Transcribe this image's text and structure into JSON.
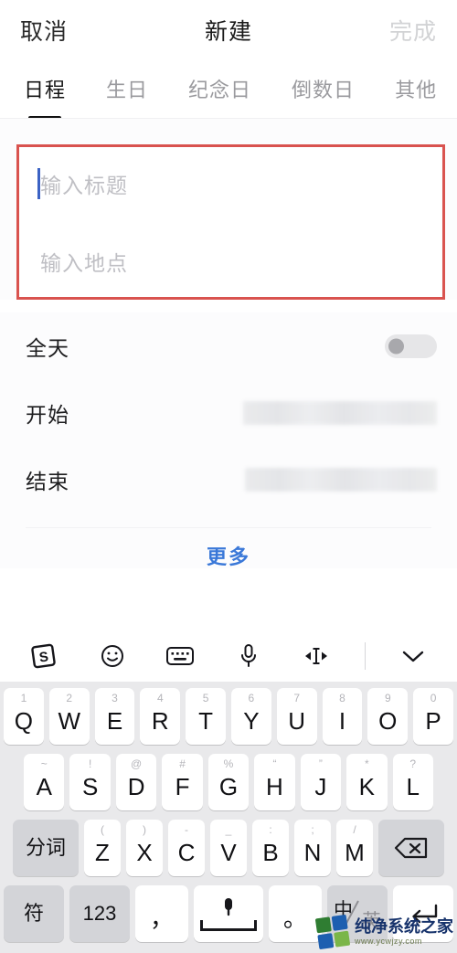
{
  "navbar": {
    "cancel_label": "取消",
    "title": "新建",
    "done_label": "完成"
  },
  "tabs": [
    {
      "label": "日程",
      "active": true
    },
    {
      "label": "生日",
      "active": false
    },
    {
      "label": "纪念日",
      "active": false
    },
    {
      "label": "倒数日",
      "active": false
    },
    {
      "label": "其他",
      "active": false
    }
  ],
  "form": {
    "title_field": {
      "value": "",
      "placeholder": "输入标题"
    },
    "location_field": {
      "value": "",
      "placeholder": "输入地点"
    },
    "annotation_color": "#d9534f"
  },
  "rows": {
    "allday": {
      "label": "全天",
      "toggle_on": false
    },
    "start": {
      "label": "开始",
      "value": ""
    },
    "end": {
      "label": "结束",
      "value": ""
    }
  },
  "more": {
    "label": "更多",
    "color": "#3a78d8"
  },
  "keyboard": {
    "toolbar": [
      {
        "name": "sogou-logo-icon",
        "label": "S"
      },
      {
        "name": "emoji-icon",
        "label": ""
      },
      {
        "name": "keyboard-icon",
        "label": ""
      },
      {
        "name": "microphone-icon",
        "label": ""
      },
      {
        "name": "cursor-move-icon",
        "label": ""
      },
      {
        "name": "collapse-keyboard-icon",
        "label": ""
      }
    ],
    "row1": [
      {
        "main": "Q",
        "sup": "1"
      },
      {
        "main": "W",
        "sup": "2"
      },
      {
        "main": "E",
        "sup": "3"
      },
      {
        "main": "R",
        "sup": "4"
      },
      {
        "main": "T",
        "sup": "5"
      },
      {
        "main": "Y",
        "sup": "6"
      },
      {
        "main": "U",
        "sup": "7"
      },
      {
        "main": "I",
        "sup": "8"
      },
      {
        "main": "O",
        "sup": "9"
      },
      {
        "main": "P",
        "sup": "0"
      }
    ],
    "row2": [
      {
        "main": "A",
        "sup": "~"
      },
      {
        "main": "S",
        "sup": "!"
      },
      {
        "main": "D",
        "sup": "@"
      },
      {
        "main": "F",
        "sup": "#"
      },
      {
        "main": "G",
        "sup": "%"
      },
      {
        "main": "H",
        "sup": "“"
      },
      {
        "main": "J",
        "sup": "”"
      },
      {
        "main": "K",
        "sup": "*"
      },
      {
        "main": "L",
        "sup": "?"
      }
    ],
    "row3": {
      "split_label": "分词",
      "keys": [
        {
          "main": "Z",
          "sup": "("
        },
        {
          "main": "X",
          "sup": ")"
        },
        {
          "main": "C",
          "sup": "-"
        },
        {
          "main": "V",
          "sup": "_"
        },
        {
          "main": "B",
          "sup": ":"
        },
        {
          "main": "N",
          "sup": ";"
        },
        {
          "main": "M",
          "sup": "/"
        }
      ],
      "backspace_label": "backspace-icon"
    },
    "row4": {
      "symbol_label": "符",
      "numeric_label": "123",
      "comma_label": "，",
      "space_label": "",
      "period_label": "。",
      "lang_zh": "中",
      "lang_en": "英",
      "enter_label": "enter-icon"
    }
  },
  "watermark": {
    "title": "纯净系统之家",
    "url": "www.ycwjzy.com",
    "colors": [
      "#2f7d32",
      "#1d5fb0",
      "#1d5fb0",
      "#7ab648"
    ]
  }
}
